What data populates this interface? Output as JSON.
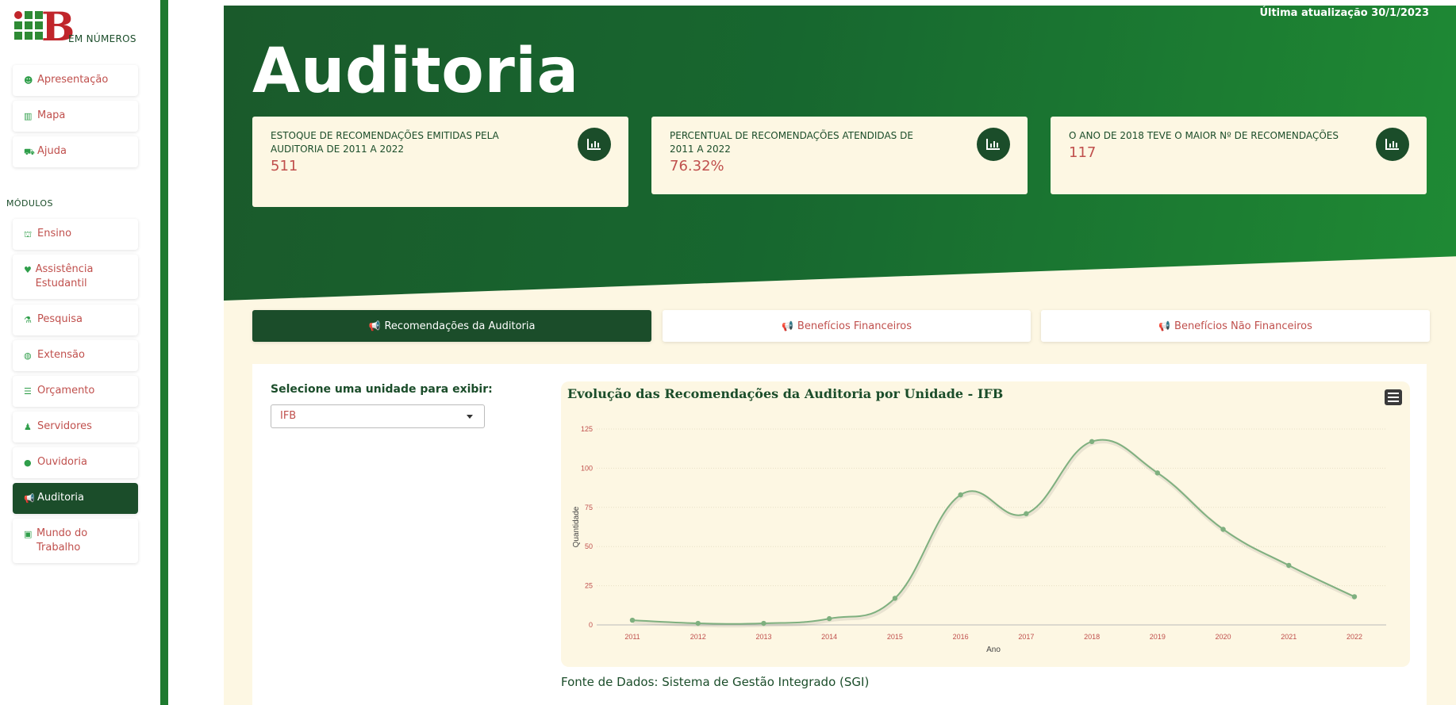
{
  "sidebar": {
    "logo_text": "EM NÚMEROS",
    "logo_letter": "B",
    "items_top": [
      {
        "label": "Apresentação",
        "icon": "smile-icon",
        "glyph": "☻"
      },
      {
        "label": "Mapa",
        "icon": "barcode-icon",
        "glyph": "▥"
      },
      {
        "label": "Ajuda",
        "icon": "truck-icon",
        "glyph": "⛟"
      }
    ],
    "modules_label": "MÓDULOS",
    "modules": [
      {
        "label": "Ensino",
        "icon": "graduation-cap-icon",
        "glyph": "⛫"
      },
      {
        "label": "Assistência Estudantil",
        "icon": "heart-icon",
        "glyph": "♥"
      },
      {
        "label": "Pesquisa",
        "icon": "microscope-icon",
        "glyph": "⚗"
      },
      {
        "label": "Extensão",
        "icon": "globe-icon",
        "glyph": "◍"
      },
      {
        "label": "Orçamento",
        "icon": "money-icon",
        "glyph": "☰"
      },
      {
        "label": "Servidores",
        "icon": "user-icon",
        "glyph": "♟"
      },
      {
        "label": "Ouvidoria",
        "icon": "comment-icon",
        "glyph": "●"
      },
      {
        "label": "Auditoria",
        "icon": "bullhorn-icon",
        "glyph": "📢",
        "active": true
      },
      {
        "label": "Mundo do Trabalho",
        "icon": "briefcase-icon",
        "glyph": "▣"
      }
    ]
  },
  "header": {
    "last_update": "Última atualização 30/1/2023",
    "title": "Auditoria"
  },
  "kpis": [
    {
      "label": "ESTOQUE DE RECOMENDAÇÕES EMITIDAS PELA AUDITORIA DE 2011 A 2022",
      "value": "511"
    },
    {
      "label": "PERCENTUAL DE RECOMENDAÇÕES ATENDIDAS DE 2011 A 2022",
      "value": "76.32%"
    },
    {
      "label": "O ANO DE 2018 TEVE O MAIOR Nº DE RECOMENDAÇÕES",
      "value": "117"
    }
  ],
  "tabs": [
    {
      "label": "Recomendações da Auditoria",
      "active": true
    },
    {
      "label": "Benefícios Financeiros",
      "active": false
    },
    {
      "label": "Benefícios Não Financeiros",
      "active": false
    }
  ],
  "filter": {
    "label": "Selecione uma unidade para exibir:",
    "selected": "IFB"
  },
  "source": "Fonte de Dados: Sistema de Gestão Integrado (SGI)",
  "colors": {
    "dark_green": "#1b4d2a",
    "accent_red": "#c0504d",
    "cream": "#fdf7e3",
    "line": "#7fb07f"
  },
  "chart_data": {
    "type": "line",
    "title": "Evolução das Recomendações da Auditoria por Unidade - IFB",
    "xlabel": "Ano",
    "ylabel": "Quantidade",
    "categories": [
      "2011",
      "2012",
      "2013",
      "2014",
      "2015",
      "2016",
      "2017",
      "2018",
      "2019",
      "2020",
      "2021",
      "2022"
    ],
    "series": [
      {
        "values": [
          3,
          1,
          1,
          4,
          17,
          83,
          71,
          117,
          97,
          61,
          38,
          18
        ]
      }
    ],
    "ylim": [
      0,
      125
    ],
    "yticks": [
      0,
      25,
      50,
      75,
      100,
      125
    ],
    "grid": true,
    "smooth": true
  }
}
